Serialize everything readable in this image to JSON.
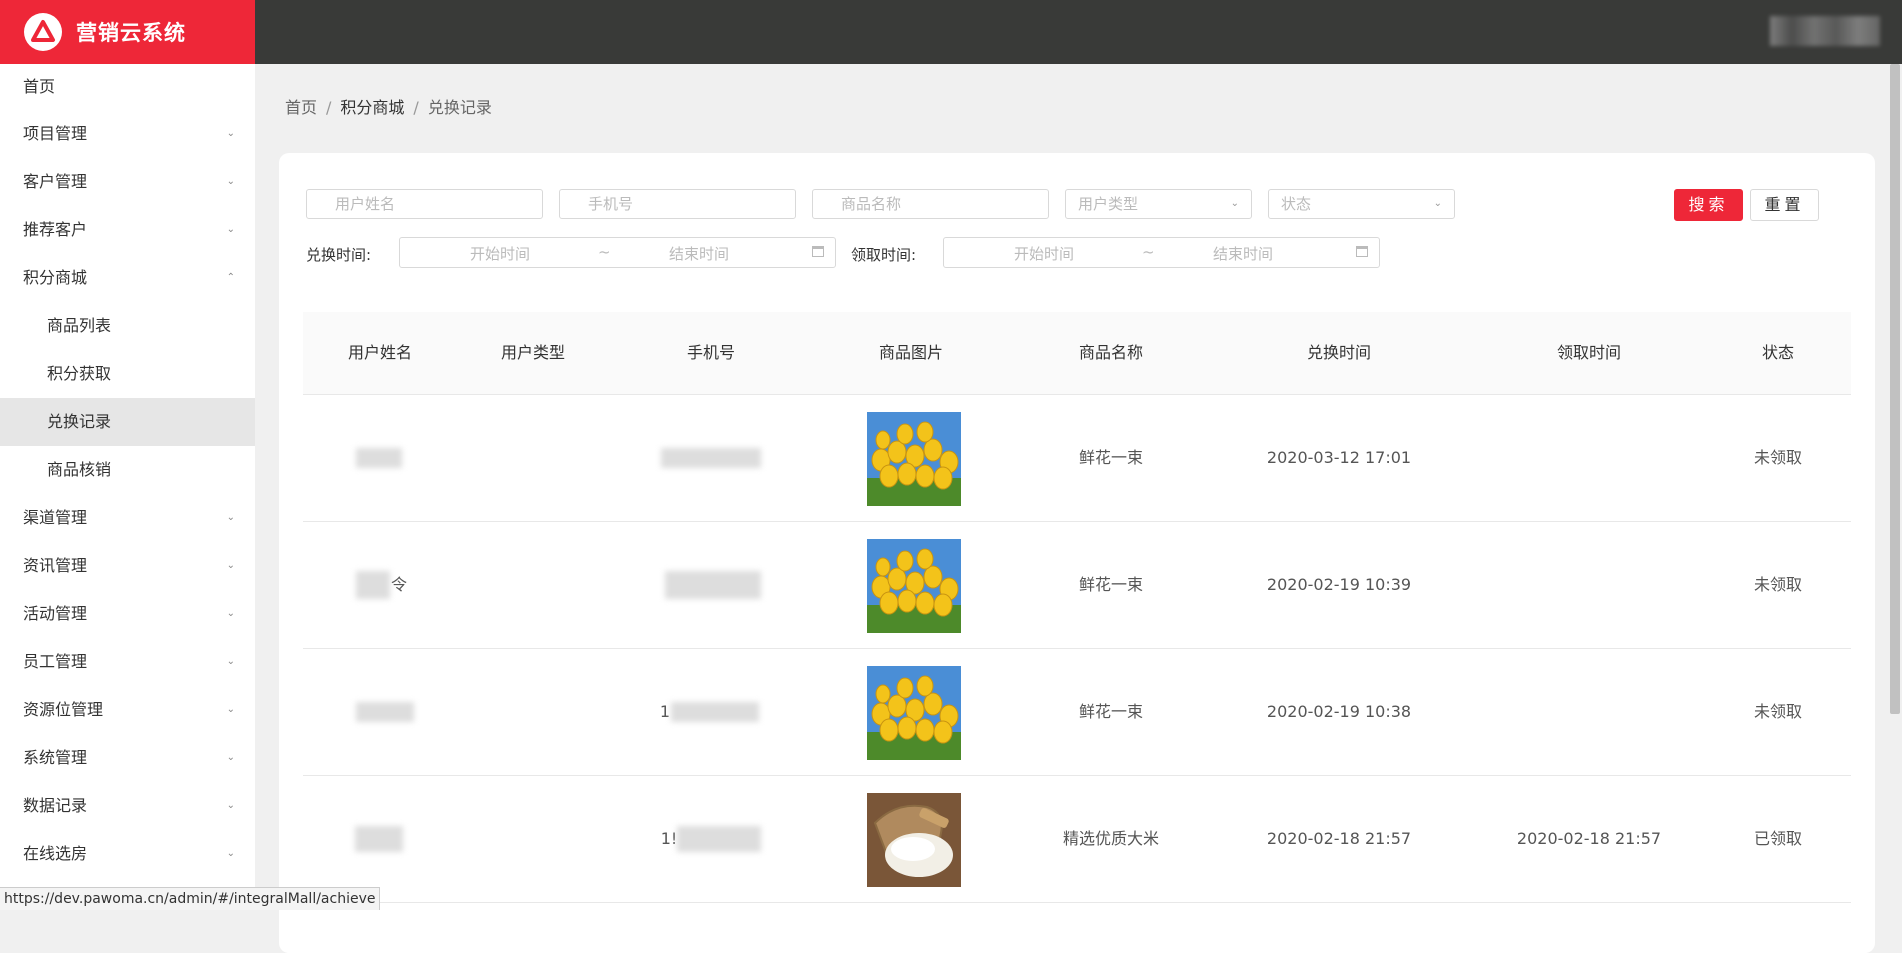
{
  "app": {
    "title": "营销云系统"
  },
  "sidebar": {
    "items": [
      {
        "label": "首页",
        "chevron": ""
      },
      {
        "label": "项目管理",
        "chevron": "⌄"
      },
      {
        "label": "客户管理",
        "chevron": "⌄"
      },
      {
        "label": "推荐客户",
        "chevron": "⌄"
      },
      {
        "label": "积分商城",
        "chevron": "⌃"
      }
    ],
    "sub_items": [
      {
        "label": "商品列表"
      },
      {
        "label": "积分获取"
      },
      {
        "label": "兑换记录"
      },
      {
        "label": "商品核销"
      }
    ],
    "items2": [
      {
        "label": "渠道管理",
        "chevron": "⌄"
      },
      {
        "label": "资讯管理",
        "chevron": "⌄"
      },
      {
        "label": "活动管理",
        "chevron": "⌄"
      },
      {
        "label": "员工管理",
        "chevron": "⌄"
      },
      {
        "label": "资源位管理",
        "chevron": "⌄"
      },
      {
        "label": "系统管理",
        "chevron": "⌄"
      },
      {
        "label": "数据记录",
        "chevron": "⌄"
      },
      {
        "label": "在线选房",
        "chevron": "⌄"
      }
    ]
  },
  "breadcrumb": {
    "home": "首页",
    "section": "积分商城",
    "current": "兑换记录",
    "sep": "/"
  },
  "filters": {
    "user_name_placeholder": "用户姓名",
    "phone_placeholder": "手机号",
    "product_name_placeholder": "商品名称",
    "user_type_placeholder": "用户类型",
    "status_placeholder": "状态",
    "search_label": "搜索",
    "reset_label": "重置",
    "exchange_time_label": "兑换时间:",
    "claim_time_label": "领取时间:",
    "start_placeholder": "开始时间",
    "end_placeholder": "结束时间",
    "range_sep": "~"
  },
  "table": {
    "headers": [
      "用户姓名",
      "用户类型",
      "手机号",
      "商品图片",
      "商品名称",
      "兑换时间",
      "领取时间",
      "状态"
    ],
    "rows": [
      {
        "user_name": "",
        "user_type": "",
        "phone": "",
        "product_image": "tulips",
        "product_name": "鲜花一束",
        "exchange_time": "2020-03-12 17:01",
        "claim_time": "",
        "status": "未领取"
      },
      {
        "user_name": "令",
        "user_type": "",
        "phone": "",
        "product_image": "tulips",
        "product_name": "鲜花一束",
        "exchange_time": "2020-02-19 10:39",
        "claim_time": "",
        "status": "未领取"
      },
      {
        "user_name": "",
        "user_type": "",
        "phone": "1",
        "product_image": "tulips",
        "product_name": "鲜花一束",
        "exchange_time": "2020-02-19 10:38",
        "claim_time": "",
        "status": "未领取"
      },
      {
        "user_name": "",
        "user_type": "",
        "phone": "1!",
        "product_image": "rice-sack",
        "product_name": "精选优质大米",
        "exchange_time": "2020-02-18 21:57",
        "claim_time": "2020-02-18 21:57",
        "status": "已领取"
      }
    ]
  },
  "status_bar": {
    "url": "https://dev.pawoma.cn/admin/#/integralMall/achieve"
  },
  "colors": {
    "brand": "#ee2738",
    "topbar": "#393a38",
    "active_bg": "#e6e6e6"
  }
}
